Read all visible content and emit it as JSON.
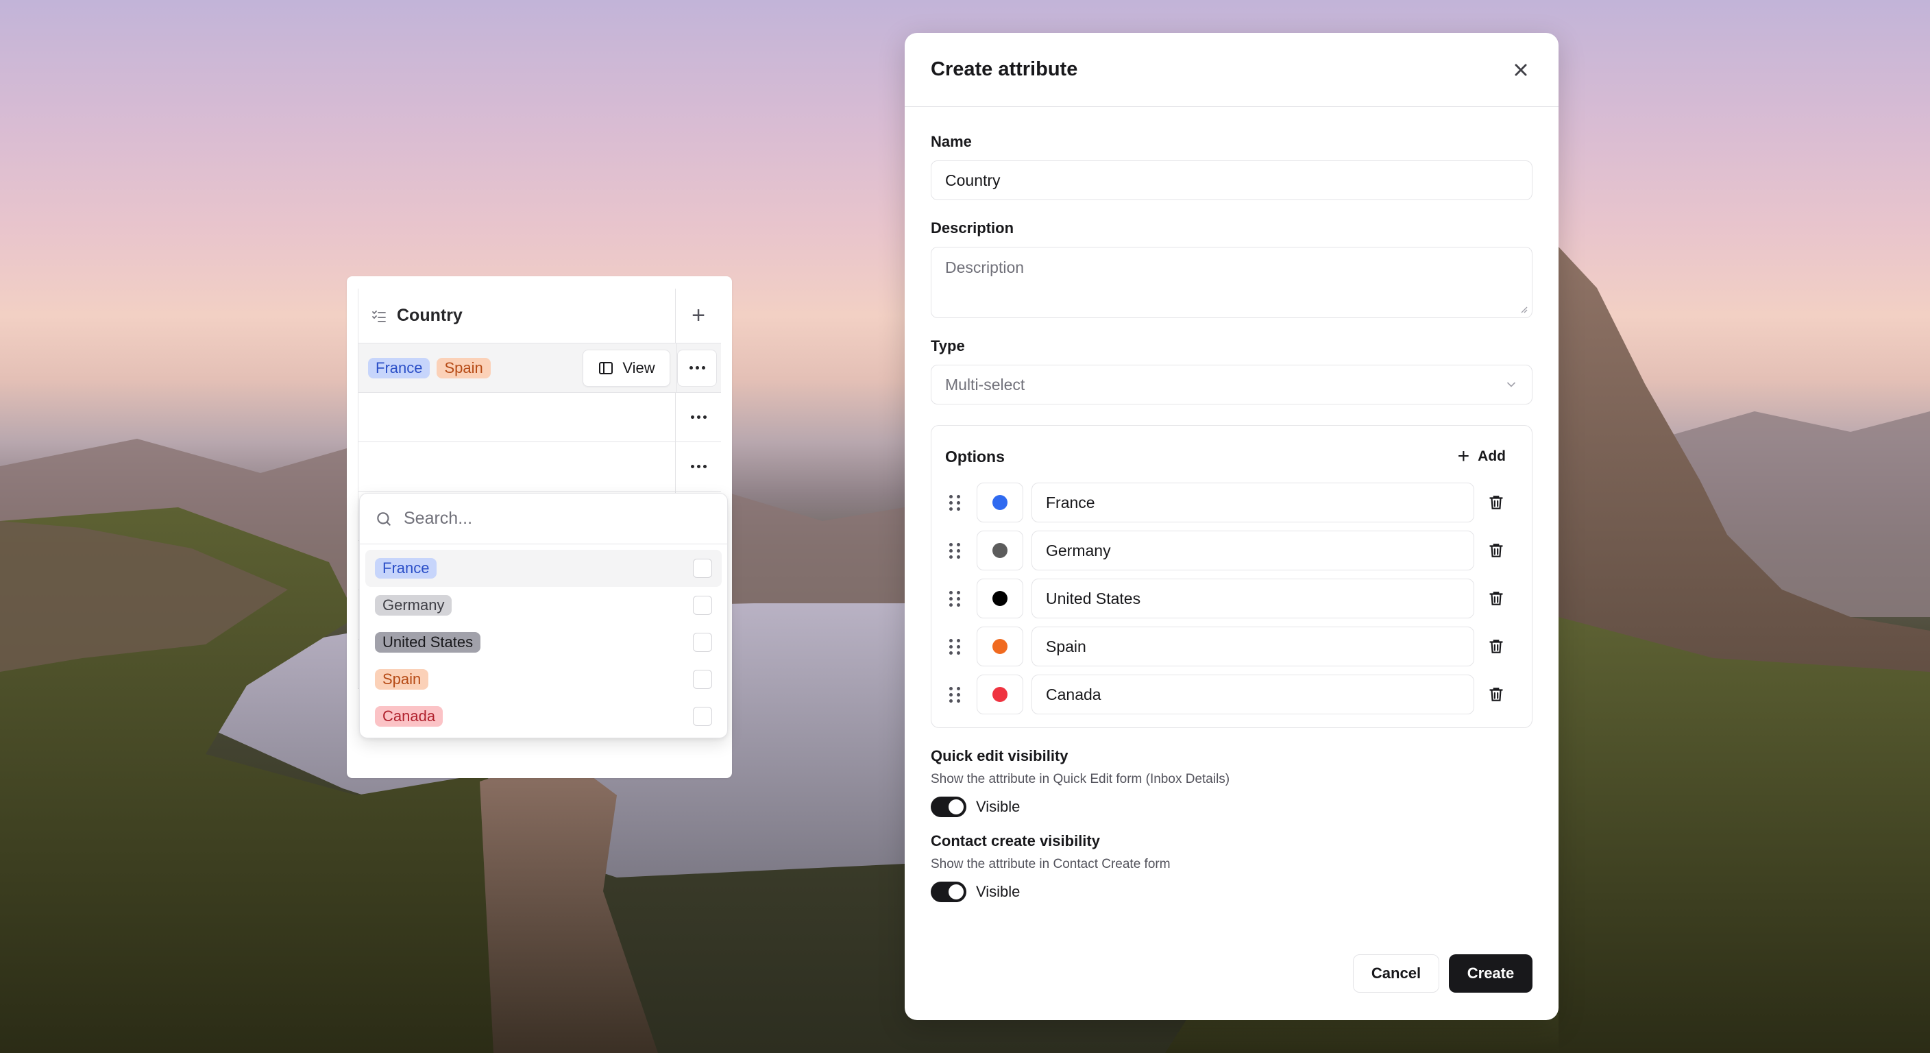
{
  "table": {
    "column_title": "Country",
    "column_icon": "list-check-icon",
    "row1_tags": [
      "France",
      "Spain"
    ],
    "view_label": "View"
  },
  "dropdown": {
    "search_placeholder": "Search...",
    "options": [
      {
        "label": "France",
        "color": "#c7d5fb"
      },
      {
        "label": "Germany",
        "color": "#d4d4d8"
      },
      {
        "label": "United States",
        "color": "#a1a1aa"
      },
      {
        "label": "Spain",
        "color": "#fbd1b8"
      },
      {
        "label": "Canada",
        "color": "#fbc3c6"
      }
    ]
  },
  "modal": {
    "title": "Create attribute",
    "name_label": "Name",
    "name_value": "Country",
    "description_label": "Description",
    "description_placeholder": "Description",
    "type_label": "Type",
    "type_value": "Multi-select",
    "options_title": "Options",
    "add_label": "Add",
    "options": [
      {
        "label": "France",
        "color": "#2f6af0"
      },
      {
        "label": "Germany",
        "color": "#5c5c5c"
      },
      {
        "label": "United States",
        "color": "#000000"
      },
      {
        "label": "Spain",
        "color": "#f06a1f"
      },
      {
        "label": "Canada",
        "color": "#ef3340"
      }
    ],
    "quick_edit_title": "Quick edit visibility",
    "quick_edit_desc": "Show the attribute in Quick Edit form (Inbox Details)",
    "quick_edit_toggle": "Visible",
    "contact_create_title": "Contact create visibility",
    "contact_create_desc": "Show the attribute in Contact Create form",
    "contact_create_toggle": "Visible",
    "cancel_label": "Cancel",
    "create_label": "Create"
  }
}
